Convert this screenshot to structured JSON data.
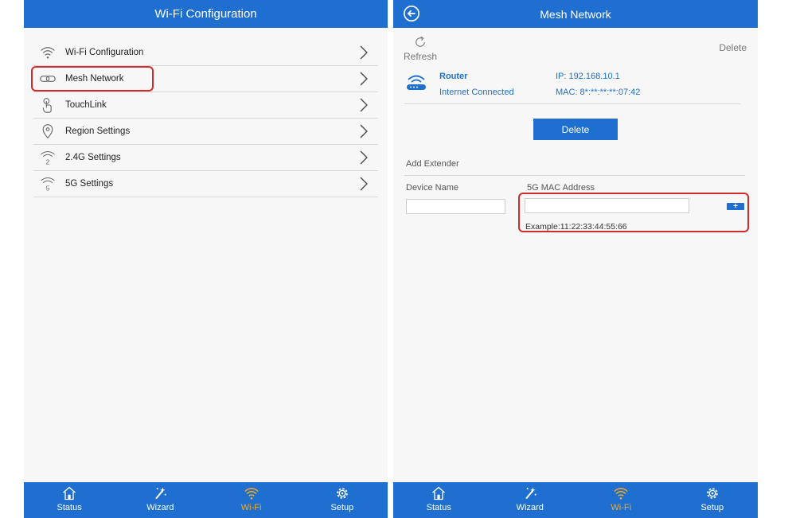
{
  "left": {
    "title": "Wi-Fi Configuration",
    "menu": [
      {
        "label": "Wi-Fi Configuration",
        "icon": "wifi-icon"
      },
      {
        "label": "Mesh Network",
        "icon": "link-icon"
      },
      {
        "label": "TouchLink",
        "icon": "touch-icon"
      },
      {
        "label": "Region Settings",
        "icon": "location-pin-icon"
      },
      {
        "label": "2.4G Settings",
        "icon": "wifi-2g-icon"
      },
      {
        "label": "5G Settings",
        "icon": "wifi-5g-icon"
      }
    ]
  },
  "right": {
    "title": "Mesh Network",
    "refresh_label": "Refresh",
    "top_delete_label": "Delete",
    "device": {
      "name": "Router",
      "status": "Internet Connected",
      "ip": "IP: 192.168.10.1",
      "mac": "MAC: 8*:**:**:**:07:42"
    },
    "delete_button_label": "Delete",
    "add_extender_label": "Add Extender",
    "device_name_label": "Device Name",
    "mac_label": "5G MAC Address",
    "device_name_value": "",
    "mac_value": "",
    "plus_label": "+",
    "example_text": "Example:11:22:33:44:55:66"
  },
  "footer": {
    "tabs": [
      {
        "label": "Status",
        "icon": "home-icon"
      },
      {
        "label": "Wizard",
        "icon": "wand-icon"
      },
      {
        "label": "Wi-Fi",
        "icon": "wifi-icon"
      },
      {
        "label": "Setup",
        "icon": "gear-icon"
      }
    ],
    "active_tab": "Wi-Fi"
  },
  "colors": {
    "primary": "#1e6fd0",
    "active_tab": "#f4a821",
    "highlight": "#d42a2a"
  }
}
